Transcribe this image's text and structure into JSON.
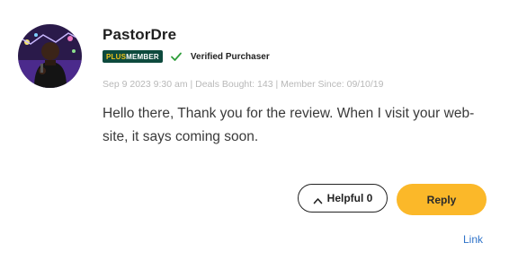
{
  "comment": {
    "username": "PastorDre",
    "badge": {
      "plus": "PLUS",
      "member": "MEMBER",
      "bg_color": "#0d4a3d",
      "plus_color": "#f0c419"
    },
    "verified_icon": "check-icon",
    "verified_label": "Verified Purchaser",
    "meta": "Sep 9 2023 9:30 am | Deals Bought: 143 | Member Since: 09/10/19",
    "body": "Hello there, Thank you for the review. When I visit your web-site, it says coming soon.",
    "actions": {
      "helpful_icon": "chevron-up-icon",
      "helpful_label": "Helpful 0",
      "reply_label": "Reply",
      "reply_color": "#fbb829",
      "link_label": "Link",
      "link_color": "#2f73c9"
    }
  }
}
